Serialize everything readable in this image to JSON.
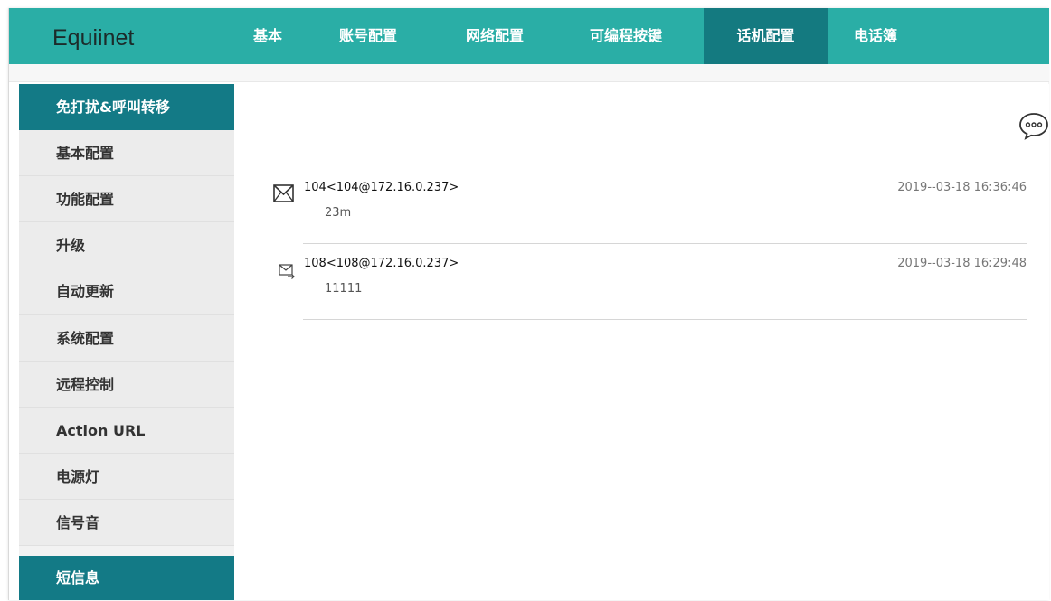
{
  "brand": "Equiinet",
  "nav": [
    {
      "label": "基本"
    },
    {
      "label": "账号配置"
    },
    {
      "label": "网络配置"
    },
    {
      "label": "可编程按键"
    },
    {
      "label": "话机配置"
    },
    {
      "label": "电话簿"
    }
  ],
  "nav_active": "话机配置",
  "sidebar": [
    {
      "label": "免打扰&呼叫转移"
    },
    {
      "label": "基本配置"
    },
    {
      "label": "功能配置"
    },
    {
      "label": "升级"
    },
    {
      "label": "自动更新"
    },
    {
      "label": "系统配置"
    },
    {
      "label": "远程控制"
    },
    {
      "label": "Action URL"
    },
    {
      "label": "电源灯"
    },
    {
      "label": "信号音"
    },
    {
      "label": "短信息"
    }
  ],
  "sidebar_highlighted": [
    "免打扰&呼叫转移",
    "短信息"
  ],
  "messages": [
    {
      "from": "104<104@172.16.0.237>",
      "body": "23m",
      "time": "2019--03-18 16:36:46",
      "icon": "envelope-icon"
    },
    {
      "from": "108<108@172.16.0.237>",
      "body": "11111",
      "time": "2019--03-18 16:29:48",
      "icon": "envelope-forward-icon"
    }
  ],
  "colors": {
    "topbar": "#2aaea6",
    "active_nav": "#147a80",
    "active_sidebar": "#137a86",
    "sidebar_bg": "#ececec"
  },
  "icons": {
    "chat": "chat-bubble-icon"
  }
}
